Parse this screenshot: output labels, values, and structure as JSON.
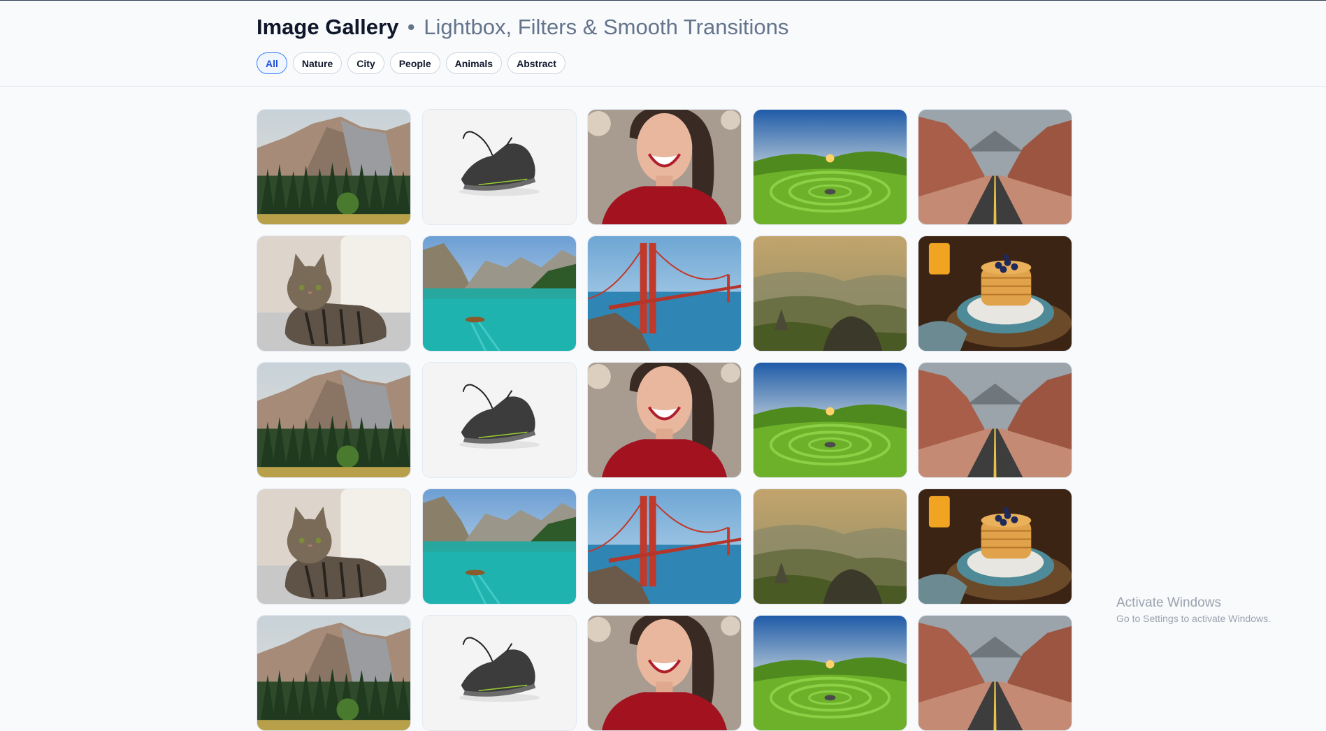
{
  "header": {
    "title": "Image Gallery",
    "subtitle_sep": "•",
    "subtitle": "Lightbox, Filters & Smooth Transitions"
  },
  "filters": [
    {
      "label": "All",
      "active": true
    },
    {
      "label": "Nature",
      "active": false
    },
    {
      "label": "City",
      "active": false
    },
    {
      "label": "People",
      "active": false
    },
    {
      "label": "Animals",
      "active": false
    },
    {
      "label": "Abstract",
      "active": false
    }
  ],
  "gallery": {
    "cycle": [
      "mountain-forest",
      "sneaker",
      "smiling-woman",
      "green-valley-sunset",
      "red-canyon-road",
      "tabby-cat",
      "turquoise-lake",
      "golden-gate-bridge",
      "misty-hills",
      "blueberry-pancakes"
    ],
    "visible_rows": 5
  },
  "os_watermark": {
    "line1": "Activate Windows",
    "line2": "Go to Settings to activate Windows."
  }
}
